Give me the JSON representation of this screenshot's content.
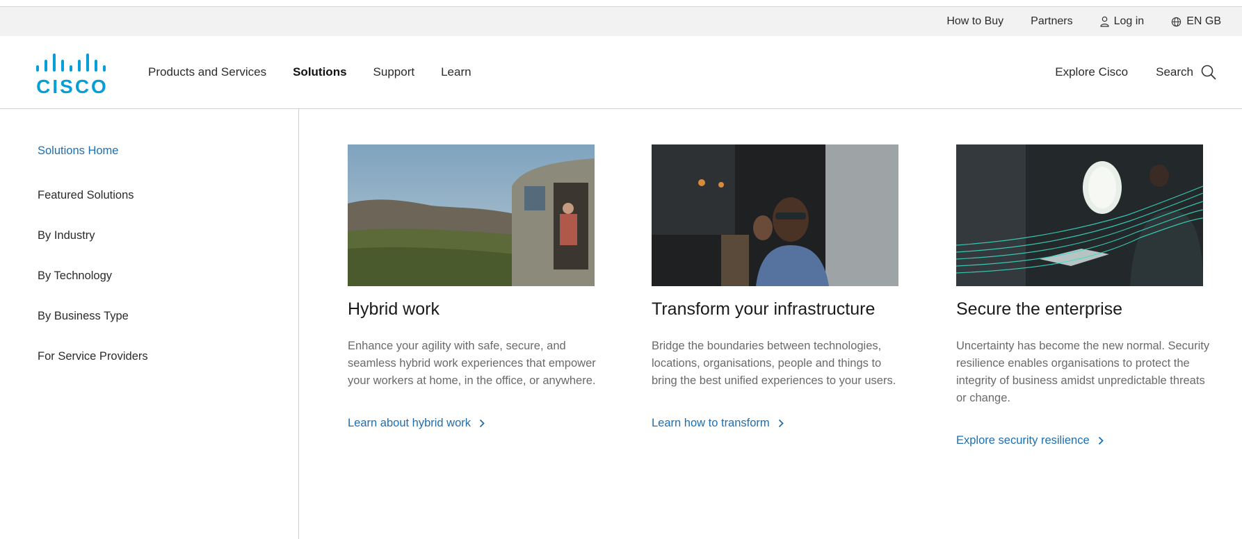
{
  "utility": {
    "how_to_buy": "How to Buy",
    "partners": "Partners",
    "login": "Log in",
    "language": "EN GB"
  },
  "brand": {
    "logo_text": "CISCO",
    "accent": "#049fd9"
  },
  "nav": {
    "items": [
      {
        "label": "Products and Services",
        "active": false
      },
      {
        "label": "Solutions",
        "active": true
      },
      {
        "label": "Support",
        "active": false
      },
      {
        "label": "Learn",
        "active": false
      }
    ],
    "explore": "Explore Cisco",
    "search": "Search"
  },
  "sidebar": {
    "items": [
      {
        "label": "Solutions Home"
      },
      {
        "label": "Featured Solutions"
      },
      {
        "label": "By Industry"
      },
      {
        "label": "By Technology"
      },
      {
        "label": "By Business Type"
      },
      {
        "label": "For Service Providers"
      }
    ]
  },
  "cards": [
    {
      "title": "Hybrid work",
      "description": "Enhance your agility with safe, secure, and seamless hybrid work experiences that empower your workers at home, in the office, or anywhere.",
      "cta": "Learn about hybrid work"
    },
    {
      "title": "Transform your infrastructure",
      "description": "Bridge the boundaries between technologies, locations, organisations, people and things to bring the best unified experiences to your users.",
      "cta": "Learn how to transform"
    },
    {
      "title": "Secure the enterprise",
      "description": "Uncertainty has become the new normal. Security resilience enables organisations to protect the integrity of business amidst unpredictable threats or change.",
      "cta": "Explore security resilience"
    }
  ],
  "colors": {
    "link": "#1b6fb3",
    "text": "#2b2b2b",
    "muted": "#6a6a6a"
  }
}
